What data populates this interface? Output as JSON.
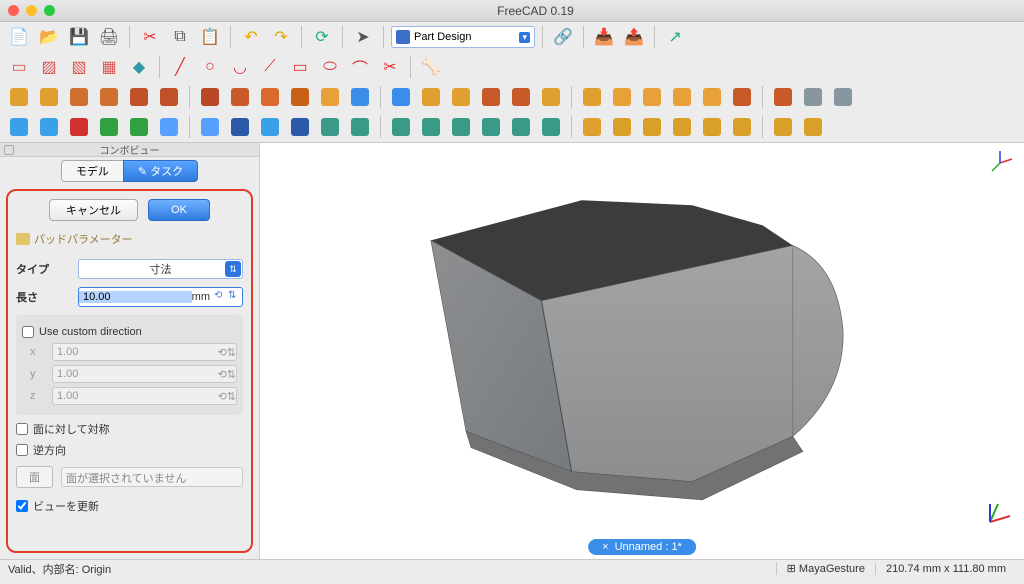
{
  "window": {
    "title": "FreeCAD 0.19"
  },
  "workbench": {
    "selected": "Part Design"
  },
  "panel": {
    "title": "コンボビュー",
    "tabs": {
      "model": "モデル",
      "task": "タスク"
    },
    "buttons": {
      "cancel": "キャンセル",
      "ok": "OK"
    },
    "section": "パッドパラメーター",
    "type_label": "タイプ",
    "type_value": "寸法",
    "length_label": "長さ",
    "length_value": "10.00",
    "length_unit": "mm",
    "custom_dir": "Use custom direction",
    "x_label": "x",
    "x_value": "1.00",
    "y_label": "y",
    "y_value": "1.00",
    "z_label": "z",
    "z_value": "1.00",
    "sym_plane": "面に対して対称",
    "reversed": "逆方向",
    "face_btn": "面",
    "face_placeholder": "面が選択されていません",
    "update_view": "ビューを更新"
  },
  "doc_tab": {
    "label": "Unnamed : 1*"
  },
  "status": {
    "left": "Valid、内部名: Origin",
    "nav": "MayaGesture",
    "dims": "210.74 mm x 111.80 mm"
  },
  "icons": {
    "row1": [
      "new",
      "open",
      "save",
      "print",
      "cut",
      "copy",
      "paste",
      "undo",
      "redo",
      "refresh",
      "cursor",
      "link",
      "import",
      "export",
      "share"
    ],
    "row2": [
      "a1",
      "a2",
      "a3",
      "a4",
      "a5",
      "line",
      "circle",
      "arc",
      "poly",
      "rect",
      "slot",
      "fillet",
      "trim",
      "bone"
    ],
    "row3": [
      "p1",
      "p2",
      "p3",
      "p4",
      "p5",
      "p6",
      "p7",
      "p8",
      "p9",
      "p10",
      "p11",
      "p12",
      "p13",
      "p14",
      "p15",
      "p16",
      "p17",
      "p18",
      "p19",
      "p20",
      "p21",
      "p22",
      "p23",
      "p24",
      "p25",
      "p26",
      "p27"
    ],
    "row4": [
      "fit",
      "zoom",
      "noview",
      "select",
      "box",
      "left",
      "right",
      "iso",
      "zplus",
      "iso2",
      "v1",
      "v2",
      "v3",
      "v4",
      "v5",
      "v6",
      "v7",
      "v8",
      "measure",
      "m1",
      "m2",
      "m3",
      "m4",
      "m5",
      "m6",
      "m7"
    ]
  },
  "colors": {
    "row3": [
      "#e0a030",
      "#e0a030",
      "#d07030",
      "#d07030",
      "#c05028",
      "#c05028",
      "#b84826",
      "#c85a2a",
      "#d86a30",
      "#c86018",
      "#e8a038",
      "#3a8de8",
      "#3a8de8",
      "#e0a030",
      "#e0a030",
      "#c85a2a",
      "#c85a2a",
      "#e0a030",
      "#e0a030",
      "#e8a038",
      "#e8a038",
      "#e8a038",
      "#e8a038",
      "#c85a2a",
      "#c85a2a",
      "#8896a0",
      "#8896a0"
    ],
    "row4": [
      "#3aa0e8",
      "#3aa0e8",
      "#d03030",
      "#30a040",
      "#30a040",
      "#58a0ff",
      "#58a0ff",
      "#2a5aa8",
      "#3aa0e8",
      "#2a5aa8",
      "#3a9a88",
      "#3a9a88",
      "#3a9a88",
      "#3a9a88",
      "#3a9a88",
      "#3a9a88",
      "#3a9a88",
      "#3a9a88",
      "#e0a030",
      "#d8a028",
      "#d8a028",
      "#d8a028",
      "#d8a028",
      "#d8a028",
      "#d8a028",
      "#d8a028"
    ]
  }
}
